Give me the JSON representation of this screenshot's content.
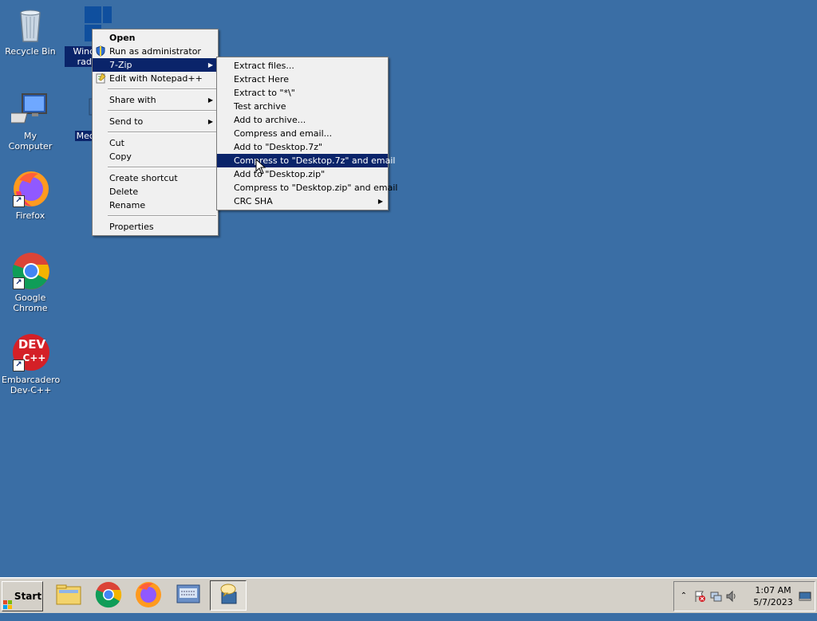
{
  "desktop": {
    "icons": [
      {
        "name": "recycle-bin",
        "label": "Recycle Bin"
      },
      {
        "name": "windows-radeon",
        "label": "Windows radeon"
      },
      {
        "name": "my-computer",
        "label": "My Computer"
      },
      {
        "name": "mediac",
        "label": "MediaC"
      },
      {
        "name": "firefox",
        "label": "Firefox"
      },
      {
        "name": "google-chrome",
        "label": "Google Chrome"
      },
      {
        "name": "embarcadero-devcpp",
        "label": "Embarcadero Dev-C++"
      }
    ],
    "devcpp_badge": "DEV",
    "devcpp_badge2": "C++"
  },
  "context_menu": {
    "items": [
      {
        "label": "Open"
      },
      {
        "label": "Run as administrator"
      },
      {
        "label": "7-Zip"
      },
      {
        "label": "Edit with Notepad++"
      },
      {
        "label": "Share with"
      },
      {
        "label": "Send to"
      },
      {
        "label": "Cut"
      },
      {
        "label": "Copy"
      },
      {
        "label": "Create shortcut"
      },
      {
        "label": "Delete"
      },
      {
        "label": "Rename"
      },
      {
        "label": "Properties"
      }
    ]
  },
  "zip_submenu": {
    "items": [
      {
        "label": "Extract files..."
      },
      {
        "label": "Extract Here"
      },
      {
        "label": "Extract to \"*\\\""
      },
      {
        "label": "Test archive"
      },
      {
        "label": "Add to archive..."
      },
      {
        "label": "Compress and email..."
      },
      {
        "label": "Add to \"Desktop.7z\""
      },
      {
        "label": "Compress to \"Desktop.7z\" and email"
      },
      {
        "label": "Add to \"Desktop.zip\""
      },
      {
        "label": "Compress to \"Desktop.zip\" and email"
      },
      {
        "label": "CRC SHA"
      }
    ],
    "highlighted_index": 7
  },
  "taskbar": {
    "start_label": "Start",
    "apps": [
      "file-explorer",
      "google-chrome",
      "firefox",
      "keyboard-app",
      "remote-chat-app"
    ],
    "clock_time": "1:07 AM",
    "clock_date": "5/7/2023"
  },
  "colors": {
    "desktop": "#3a6ea5",
    "highlight": "#0a246a",
    "menu_bg": "#f0f0f0",
    "taskbar": "#d4d0c8"
  }
}
